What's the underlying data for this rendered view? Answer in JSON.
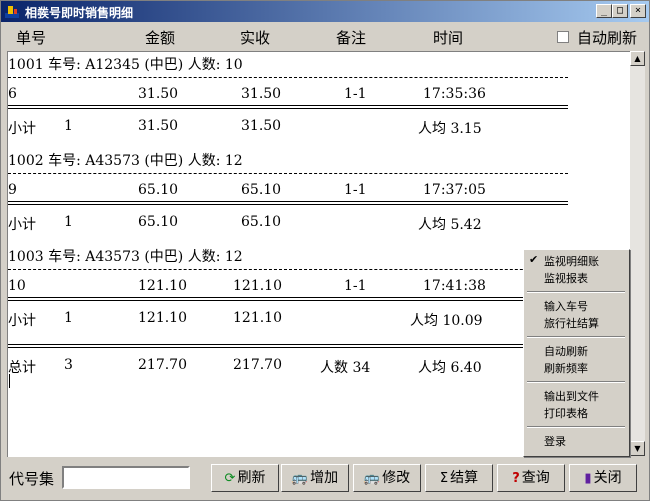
{
  "window": {
    "title": "相彂号即时销售明细",
    "minimize": "_",
    "maximize": "□",
    "close": "×"
  },
  "header": {
    "c1": "单号",
    "c2": "金额",
    "c3": "实收",
    "c4": "备注",
    "c5": "时间",
    "auto_refresh": "自动刷新"
  },
  "groups": [
    {
      "head": "1001  车号: A12345 (中巴)  人数: 10",
      "detail": {
        "no": "6",
        "amt": "31.50",
        "paid": "31.50",
        "note": "1-1",
        "time": "17:35:36"
      },
      "sub": {
        "label": "小计",
        "count": "1",
        "amt": "31.50",
        "paid": "31.50",
        "avg": "人均 3.15"
      }
    },
    {
      "head": "1002  车号: A43573 (中巴)  人数: 12",
      "detail": {
        "no": "9",
        "amt": "65.10",
        "paid": "65.10",
        "note": "1-1",
        "time": "17:37:05"
      },
      "sub": {
        "label": "小计",
        "count": "1",
        "amt": "65.10",
        "paid": "65.10",
        "avg": "人均 5.42"
      }
    },
    {
      "head": "1003  车号: A43573 (中巴)  人数: 12",
      "detail": {
        "no": "10",
        "amt": "121.10",
        "paid": "121.10",
        "note": "1-1",
        "time": "17:41:38"
      },
      "sub": {
        "label": "小计",
        "count": "1",
        "amt": "121.10",
        "paid": "121.10",
        "avg": "人均 10.09"
      }
    }
  ],
  "total": {
    "label": "总计",
    "count": "3",
    "amt": "217.70",
    "paid": "217.70",
    "people": "人数 34",
    "avg": "人均 6.40"
  },
  "context_menu": {
    "items": [
      "监视明细账",
      "监视报表",
      "输入车号",
      "旅行社结算",
      "自动刷新",
      "刷新频率",
      "输出到文件",
      "打印表格",
      "登录"
    ],
    "checked_index": 0
  },
  "bottom": {
    "code_label": "代号集",
    "code_value": ""
  },
  "buttons": {
    "refresh": "刷新",
    "add": "增加",
    "edit": "修改",
    "settle": "结算",
    "query": "查询",
    "close": "关闭"
  }
}
